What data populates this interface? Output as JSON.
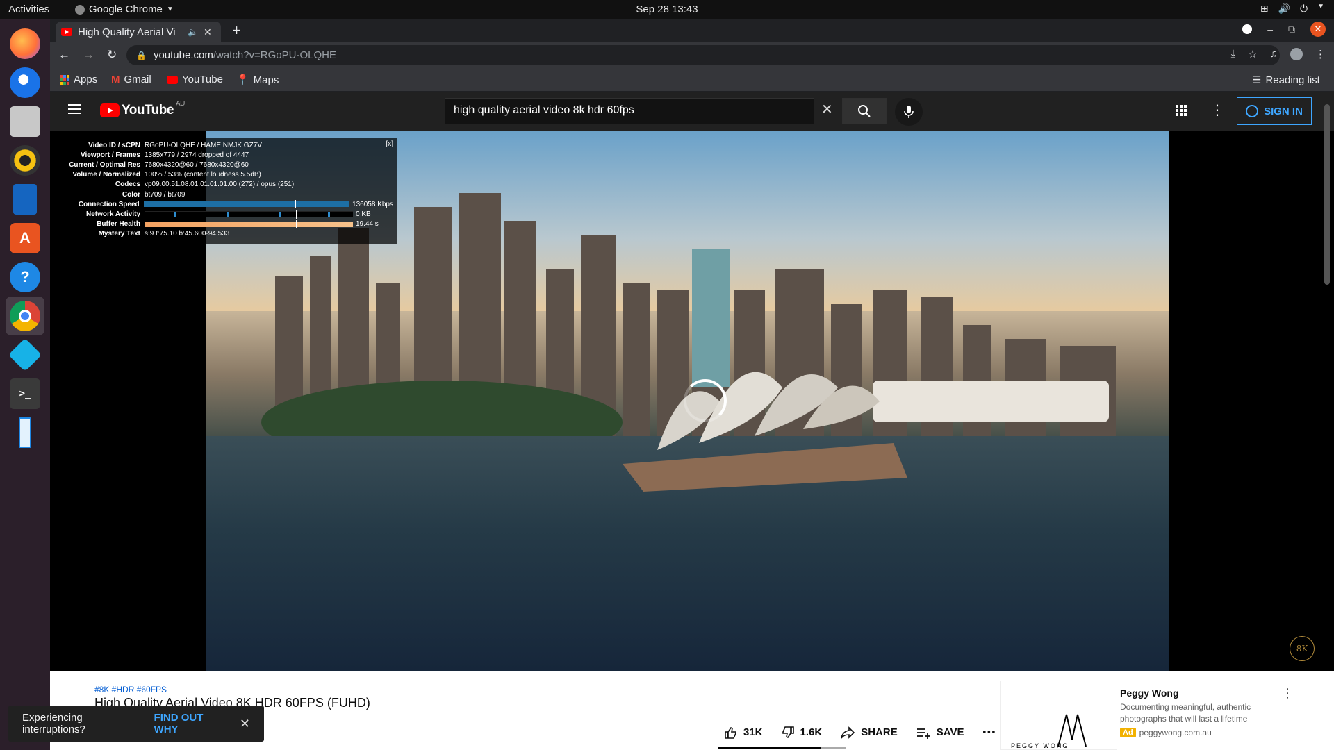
{
  "topbar": {
    "activities": "Activities",
    "app_name": "Google Chrome",
    "clock": "Sep 28  13:43"
  },
  "chrome": {
    "tab_title": "High Quality Aerial Vi",
    "url_domain": "youtube.com",
    "url_path": "/watch?v=RGoPU-OLQHE",
    "bookmarks": [
      "Apps",
      "Gmail",
      "YouTube",
      "Maps"
    ],
    "reading_list": "Reading list"
  },
  "youtube": {
    "logo_text": "YouTube",
    "region": "AU",
    "search_value": "high quality aerial video 8k hdr 60fps",
    "signin": "SIGN IN"
  },
  "stats": {
    "close": "[x]",
    "rows": [
      {
        "k": "Video ID / sCPN",
        "v": "RGoPU-OLQHE / HAME NMJK GZ7V"
      },
      {
        "k": "Viewport / Frames",
        "v": "1385x779 / 2974 dropped of 4447"
      },
      {
        "k": "Current / Optimal Res",
        "v": "7680x4320@60 / 7680x4320@60"
      },
      {
        "k": "Volume / Normalized",
        "v": "100% / 53% (content loudness 5.5dB)"
      },
      {
        "k": "Codecs",
        "v": "vp09.00.51.08.01.01.01.01.00 (272) / opus (251)"
      },
      {
        "k": "Color",
        "v": "bt709 / bt709"
      },
      {
        "k": "Connection Speed",
        "v": "136058 Kbps"
      },
      {
        "k": "Network Activity",
        "v": "0 KB"
      },
      {
        "k": "Buffer Health",
        "v": "19.44 s"
      },
      {
        "k": "Mystery Text",
        "v": "s:9 t:75.10 b:45.600-94.533"
      }
    ]
  },
  "video": {
    "watermark": "8K",
    "hashtags": "#8K #HDR #60FPS",
    "title": "High Quality Aerial Video 8K HDR 60FPS (FUHD)",
    "likes": "31K",
    "dislikes": "1.6K",
    "share": "SHARE",
    "save": "SAVE"
  },
  "ad": {
    "thumb_text": "PEGGY WONG",
    "name": "Peggy Wong",
    "desc": "Documenting meaningful, authentic photographs that will last a lifetime",
    "tag": "Ad",
    "link": "peggywong.com.au"
  },
  "toast": {
    "message": "Experiencing interruptions?",
    "action": "FIND OUT WHY"
  }
}
